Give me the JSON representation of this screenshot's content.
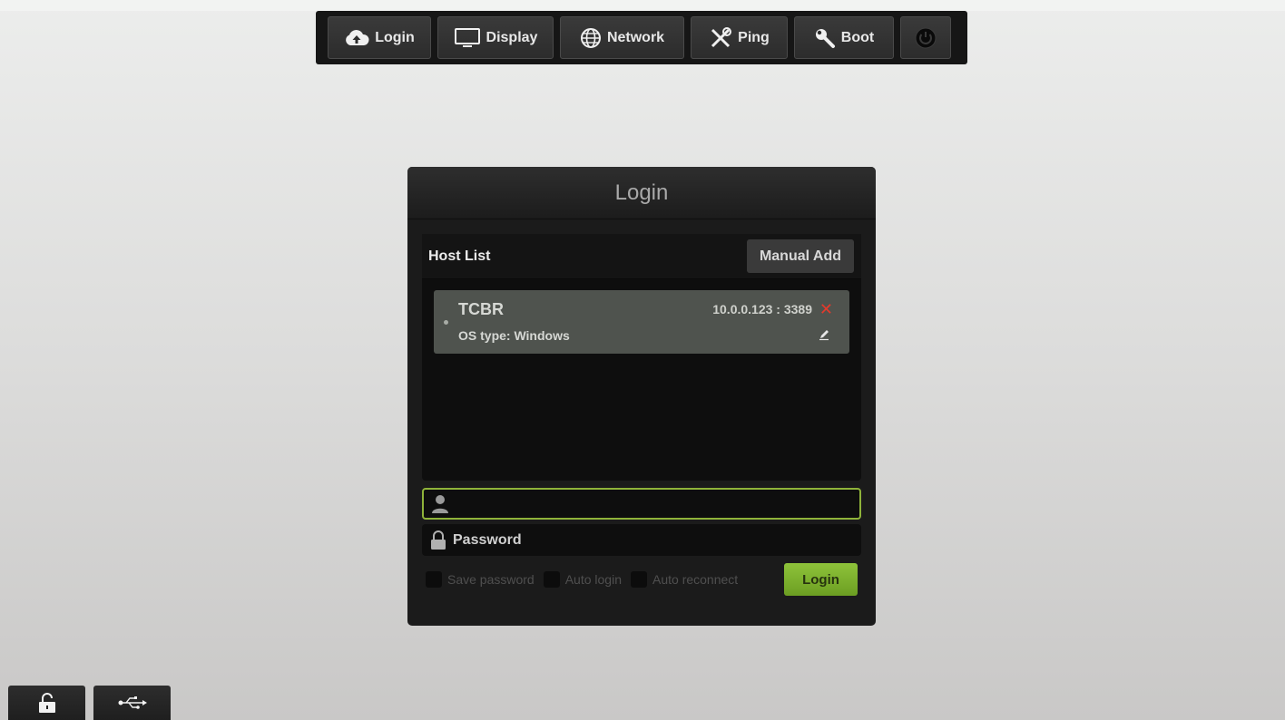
{
  "toolbar": {
    "items": [
      {
        "label": "Login",
        "icon": "cloud-upload-icon"
      },
      {
        "label": "Display",
        "icon": "monitor-icon"
      },
      {
        "label": "Network",
        "icon": "globe-icon"
      },
      {
        "label": "Ping",
        "icon": "tools-icon"
      },
      {
        "label": "Boot",
        "icon": "wrench-icon"
      },
      {
        "label": "",
        "icon": "power-icon"
      }
    ]
  },
  "dialog": {
    "title": "Login",
    "host_list": {
      "title": "Host List",
      "manual_add_label": "Manual Add",
      "hosts": [
        {
          "name": "TCBR",
          "os": "OS type: Windows",
          "address": "10.0.0.123 : 3389"
        }
      ]
    },
    "username": {
      "value": "",
      "placeholder": ""
    },
    "password": {
      "value": "",
      "placeholder": "Password"
    },
    "options": {
      "save_password": "Save password",
      "auto_login": "Auto login",
      "auto_reconnect": "Auto reconnect"
    },
    "login_button": "Login"
  },
  "bottom_bar": {
    "items": [
      {
        "icon": "lock-icon"
      },
      {
        "icon": "usb-icon"
      }
    ]
  },
  "colors": {
    "accent": "#8ec33a",
    "delete": "#e33a2c",
    "dialog_bg": "#1b1b1b"
  }
}
